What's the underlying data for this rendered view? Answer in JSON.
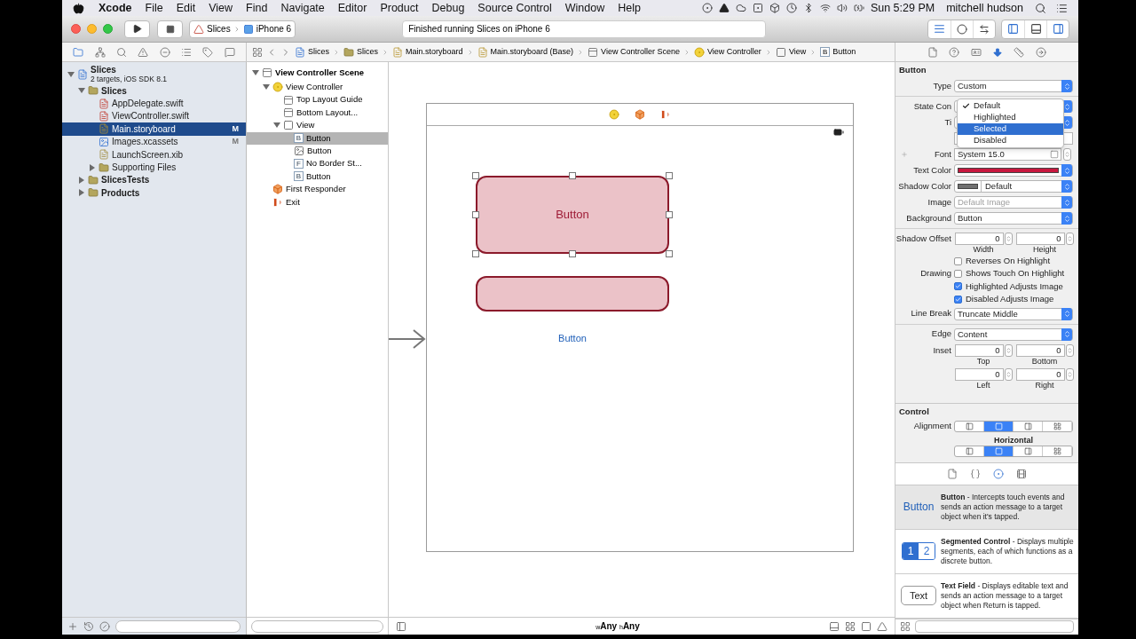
{
  "menu_bar": {
    "items": [
      "Xcode",
      "File",
      "Edit",
      "View",
      "Find",
      "Navigate",
      "Editor",
      "Product",
      "Debug",
      "Source Control",
      "Window",
      "Help"
    ],
    "clock": "Sun 5:29 PM",
    "user": "mitchell hudson"
  },
  "toolbar": {
    "scheme": "Slices",
    "device": "iPhone 6",
    "status": "Finished running Slices on iPhone 6"
  },
  "navigator_tabs": [
    {
      "selected": true
    },
    {
      "selected": false
    },
    {
      "selected": false
    },
    {
      "selected": false
    },
    {
      "selected": false
    },
    {
      "selected": false
    },
    {
      "selected": false
    },
    {
      "selected": false
    }
  ],
  "project_tree": [
    {
      "name": "Slices",
      "subtitle": "2 targets, iOS SDK 8.1",
      "kind": "project",
      "expanded": true,
      "selected": false,
      "children": [
        {
          "name": "Slices",
          "kind": "folder",
          "expanded": true,
          "selected": false,
          "children": [
            {
              "name": "AppDelegate.swift",
              "kind": "swift",
              "selected": false
            },
            {
              "name": "ViewController.swift",
              "kind": "swift",
              "selected": false
            },
            {
              "name": "Main.storyboard",
              "kind": "storyboard",
              "selected": true,
              "badge": "M"
            },
            {
              "name": "Images.xcassets",
              "kind": "assets",
              "selected": false,
              "badge": "M"
            },
            {
              "name": "LaunchScreen.xib",
              "kind": "xib",
              "selected": false
            },
            {
              "name": "Supporting Files",
              "kind": "folder",
              "expanded": false,
              "selected": false
            }
          ]
        },
        {
          "name": "SlicesTests",
          "kind": "folder",
          "expanded": false,
          "selected": false
        },
        {
          "name": "Products",
          "kind": "folder",
          "expanded": false,
          "selected": false
        }
      ]
    }
  ],
  "breadcrumb": [
    {
      "label": "Slices",
      "kind": "project"
    },
    {
      "label": "Slices",
      "kind": "folder"
    },
    {
      "label": "Main.storyboard",
      "kind": "storyboard"
    },
    {
      "label": "Main.storyboard (Base)",
      "kind": "storyboard"
    },
    {
      "label": "View Controller Scene",
      "kind": "scene"
    },
    {
      "label": "View Controller",
      "kind": "controller"
    },
    {
      "label": "View",
      "kind": "view"
    },
    {
      "label": "Button",
      "kind": "letter",
      "glyph": "B"
    }
  ],
  "inspector_tabs": [
    {
      "selected": false
    },
    {
      "selected": false
    },
    {
      "selected": false
    },
    {
      "selected": true
    },
    {
      "selected": false
    },
    {
      "selected": false
    }
  ],
  "outline": [
    {
      "name": "View Controller Scene",
      "kind": "scene",
      "expanded": true,
      "selected": false,
      "children": [
        {
          "name": "View Controller",
          "kind": "controller",
          "expanded": true,
          "selected": false,
          "children": [
            {
              "name": "Top Layout Guide",
              "kind": "guide",
              "selected": false
            },
            {
              "name": "Bottom Layout...",
              "kind": "guide",
              "selected": false
            },
            {
              "name": "View",
              "kind": "view",
              "expanded": true,
              "selected": false,
              "children": [
                {
                  "name": "Button",
                  "kind": "letter",
                  "glyph": "B",
                  "selected": true
                },
                {
                  "name": "Button",
                  "kind": "image_button",
                  "selected": false
                },
                {
                  "name": "No Border St...",
                  "kind": "letter",
                  "glyph": "F",
                  "selected": false
                },
                {
                  "name": "Button",
                  "kind": "letter",
                  "glyph": "B",
                  "selected": false
                }
              ]
            }
          ]
        },
        {
          "name": "First Responder",
          "kind": "responder",
          "selected": false
        },
        {
          "name": "Exit",
          "kind": "exit",
          "selected": false
        }
      ]
    }
  ],
  "canvas": {
    "buttons": [
      {
        "kind": "filled",
        "title": "Button",
        "selected": true
      },
      {
        "kind": "filled",
        "selected": false
      },
      {
        "kind": "plain",
        "title": "Button",
        "selected": false
      }
    ],
    "size_class": {
      "width_prefix": "w",
      "width": "Any",
      "height_prefix": "h",
      "height": "Any"
    }
  },
  "inspector": {
    "title": "Button",
    "rows": [
      {
        "kind": "select",
        "label": "Type",
        "value": "Custom"
      },
      {
        "kind": "divider"
      },
      {
        "kind": "select",
        "label": "State Con"
      },
      {
        "kind": "select",
        "label": "Ti"
      },
      {
        "kind": "text"
      },
      {
        "kind": "font",
        "label": "Font",
        "value": "System 15.0"
      },
      {
        "kind": "color",
        "label": "Text Color",
        "color": "#c8173e"
      },
      {
        "kind": "color",
        "label": "Shadow Color",
        "color": "#707070",
        "value": "Default"
      },
      {
        "kind": "select",
        "label": "Image",
        "placeholder": "Default Image"
      },
      {
        "kind": "select",
        "label": "Background",
        "value": "Button"
      },
      {
        "kind": "divider"
      },
      {
        "kind": "pair",
        "label": "Shadow Offset",
        "fields": [
          {
            "value": "0",
            "caption": "Width"
          },
          {
            "value": "0",
            "caption": "Height"
          }
        ]
      },
      {
        "kind": "checkbox",
        "text": "Reverses On Highlight",
        "checked": false
      },
      {
        "kind": "checkbox",
        "label": "Drawing",
        "text": "Shows Touch On Highlight",
        "checked": false
      },
      {
        "kind": "checkbox",
        "text": "Highlighted Adjusts Image",
        "checked": true
      },
      {
        "kind": "checkbox",
        "text": "Disabled Adjusts Image",
        "checked": true
      },
      {
        "kind": "select",
        "label": "Line Break",
        "value": "Truncate Middle"
      },
      {
        "kind": "divider"
      },
      {
        "kind": "select",
        "label": "Edge",
        "value": "Content"
      },
      {
        "kind": "pair",
        "label": "Inset",
        "fields": [
          {
            "value": "0",
            "caption": "Top"
          },
          {
            "value": "0",
            "caption": "Bottom"
          }
        ]
      },
      {
        "kind": "pair",
        "fields": [
          {
            "value": "0",
            "caption": "Left"
          },
          {
            "value": "0",
            "caption": "Right"
          }
        ]
      }
    ],
    "state_menu": [
      {
        "label": "Default",
        "checked": true,
        "selected": false
      },
      {
        "label": "Highlighted",
        "checked": false,
        "selected": false
      },
      {
        "label": "Selected",
        "checked": false,
        "selected": true
      },
      {
        "label": "Disabled",
        "checked": false,
        "selected": false
      }
    ]
  },
  "control": {
    "title": "Control",
    "label": "Alignment",
    "caption": "Horizontal",
    "horizontal": [
      {
        "selected": false
      },
      {
        "selected": true
      },
      {
        "selected": false
      },
      {
        "selected": false
      }
    ],
    "vertical": [
      {
        "selected": false
      },
      {
        "selected": true
      },
      {
        "selected": false
      },
      {
        "selected": false
      }
    ]
  },
  "library_tabs": [
    {
      "selected": false
    },
    {
      "selected": false
    },
    {
      "selected": true
    },
    {
      "selected": false
    }
  ],
  "library": [
    {
      "kind": "button",
      "preview": "Button",
      "description": "**Button** - Intercepts touch events and sends an action message to a target object when it's tapped.",
      "selected": true
    },
    {
      "kind": "segmented",
      "segments": [
        {
          "label": "1",
          "selected": true
        },
        {
          "label": "2",
          "selected": false
        }
      ],
      "description": "**Segmented Control** - Displays multiple segments, each of which functions as a discrete button.",
      "selected": false
    },
    {
      "kind": "textfield",
      "preview": "Text",
      "description": "**Text Field** - Displays editable text and sends an action message to a target object when Return is tapped.",
      "selected": false
    }
  ]
}
